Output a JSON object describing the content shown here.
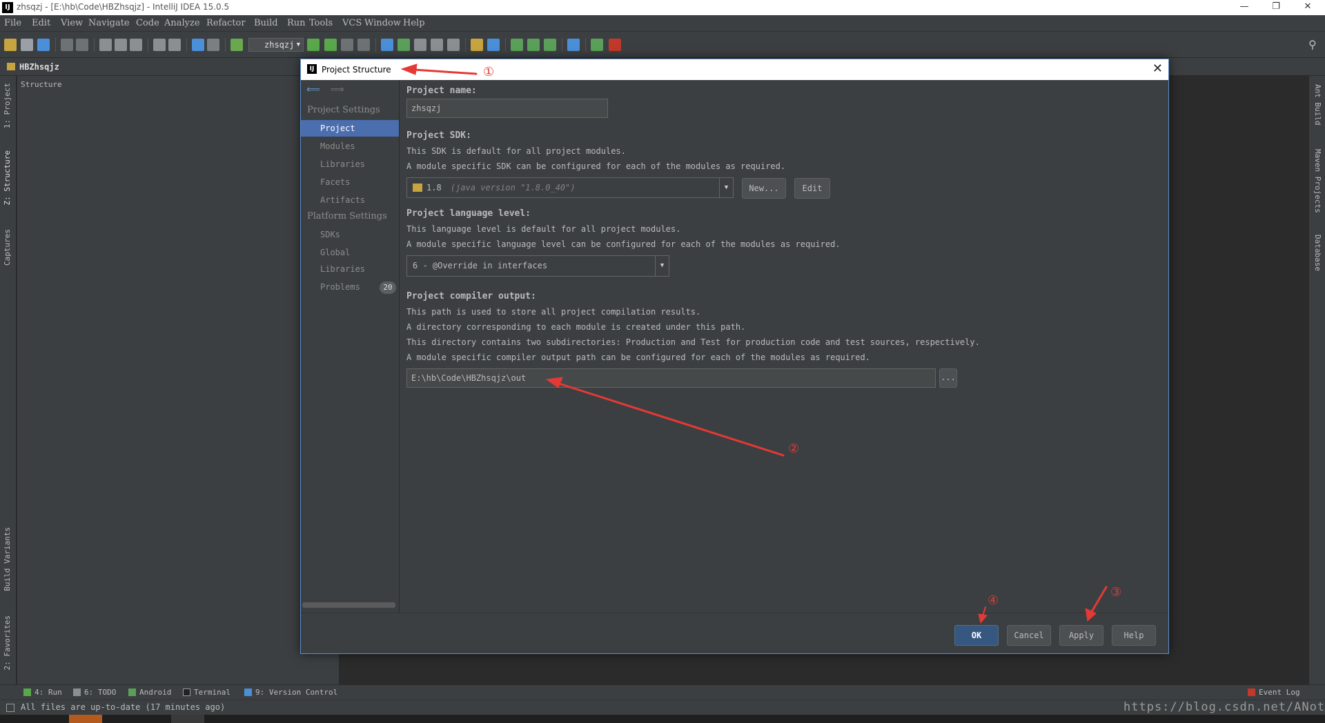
{
  "window": {
    "title": "zhsqzj - [E:\\hb\\Code\\HBZhsqjz] - IntelliJ IDEA 15.0.5",
    "app_icon_label": "IJ"
  },
  "menu": [
    "File",
    "Edit",
    "View",
    "Navigate",
    "Code",
    "Analyze",
    "Refactor",
    "Build",
    "Run",
    "Tools",
    "VCS",
    "Window",
    "Help"
  ],
  "toolbar": {
    "run_config": "zhsqzj"
  },
  "breadcrumb": {
    "project": "HBZhsqjz"
  },
  "left_tools": [
    "1: Project",
    "Z: Structure",
    "Captures",
    "Build Variants",
    "2: Favorites"
  ],
  "right_tools": [
    "Ant Build",
    "Maven Projects",
    "Database"
  ],
  "structure_panel": {
    "title": "Structure"
  },
  "dialog": {
    "title": "Project Structure",
    "close": "✕",
    "nav": {
      "project_settings_header": "Project Settings",
      "project_settings": [
        "Project",
        "Modules",
        "Libraries",
        "Facets",
        "Artifacts"
      ],
      "platform_settings_header": "Platform Settings",
      "platform_settings": [
        "SDKs",
        "Global Libraries"
      ],
      "problems_label": "Problems",
      "problems_count": "20"
    },
    "content": {
      "project_name_label": "Project name:",
      "project_name_value": "zhsqzj",
      "sdk_label": "Project SDK:",
      "sdk_desc1": "This SDK is default for all project modules.",
      "sdk_desc2": "A module specific SDK can be configured for each of the modules as required.",
      "sdk_value": "1.8",
      "sdk_version": "(java version \"1.8.0_40\")",
      "sdk_new_button": "New...",
      "sdk_edit_button": "Edit",
      "lang_label": "Project language level:",
      "lang_desc1": "This language level is default for all project modules.",
      "lang_desc2": "A module specific language level can be configured for each of the modules as required.",
      "lang_value": "6 - @Override in interfaces",
      "compiler_label": "Project compiler output:",
      "compiler_desc1": "This path is used to store all project compilation results.",
      "compiler_desc2": "A directory corresponding to each module is created under this path.",
      "compiler_desc3": "This directory contains two subdirectories: Production and Test for production code and test sources, respectively.",
      "compiler_desc4": "A module specific compiler output path can be configured for each of the modules as required.",
      "compiler_path": "E:\\hb\\Code\\HBZhsqjz\\out",
      "browse_button": "..."
    },
    "buttons": {
      "ok": "OK",
      "cancel": "Cancel",
      "apply": "Apply",
      "help": "Help"
    }
  },
  "bottom_tabs": {
    "run": "4: Run",
    "todo": "6: TODO",
    "android": "Android",
    "terminal": "Terminal",
    "vcs": "9: Version Control",
    "event_log": "Event Log"
  },
  "status": {
    "message": "All files are up-to-date (17 minutes ago)"
  },
  "watermark": "https://blog.csdn.net/ANote",
  "annotations": [
    "①",
    "②",
    "③",
    "④"
  ],
  "colors": {
    "selection": "#4b6eaf",
    "annotation": "#e53935",
    "ok_button": "#365880"
  }
}
